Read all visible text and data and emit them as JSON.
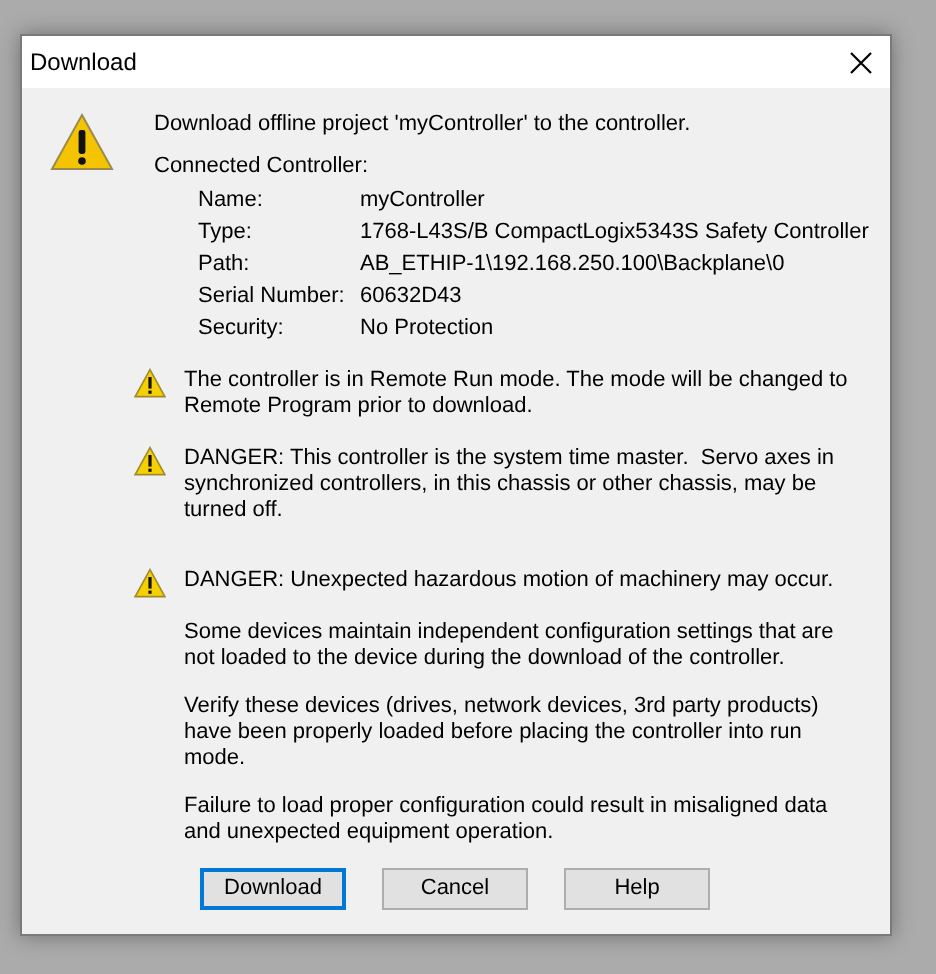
{
  "window": {
    "title": "Download"
  },
  "message": "Download offline project 'myController' to the controller.",
  "connected_heading": "Connected Controller:",
  "details": [
    {
      "label": "Name:",
      "value": "myController"
    },
    {
      "label": "Type:",
      "value": "1768-L43S/B CompactLogix5343S Safety Controller"
    },
    {
      "label": "Path:",
      "value": "AB_ETHIP-1\\192.168.250.100\\Backplane\\0"
    },
    {
      "label": "Serial Number:",
      "value": "60632D43"
    },
    {
      "label": "Security:",
      "value": "No Protection"
    }
  ],
  "warnings": [
    {
      "text": "The controller is in Remote Run mode. The mode will be changed to Remote Program prior to download."
    },
    {
      "text": "DANGER: This controller is the system time master.  Servo axes in synchronized controllers, in this chassis or other chassis, may be turned off."
    },
    {
      "text": "DANGER: Unexpected hazardous motion of machinery may occur."
    }
  ],
  "notes": [
    "Some devices maintain independent configuration settings that are not loaded to the device during the download of the controller.",
    "Verify these devices (drives, network devices, 3rd party products) have been properly loaded before placing the controller into run mode.",
    "Failure to load proper configuration could result in misaligned data and unexpected equipment operation."
  ],
  "buttons": [
    {
      "label": "Download",
      "focused": true
    },
    {
      "label": "Cancel",
      "focused": false
    },
    {
      "label": "Help",
      "focused": false
    }
  ]
}
